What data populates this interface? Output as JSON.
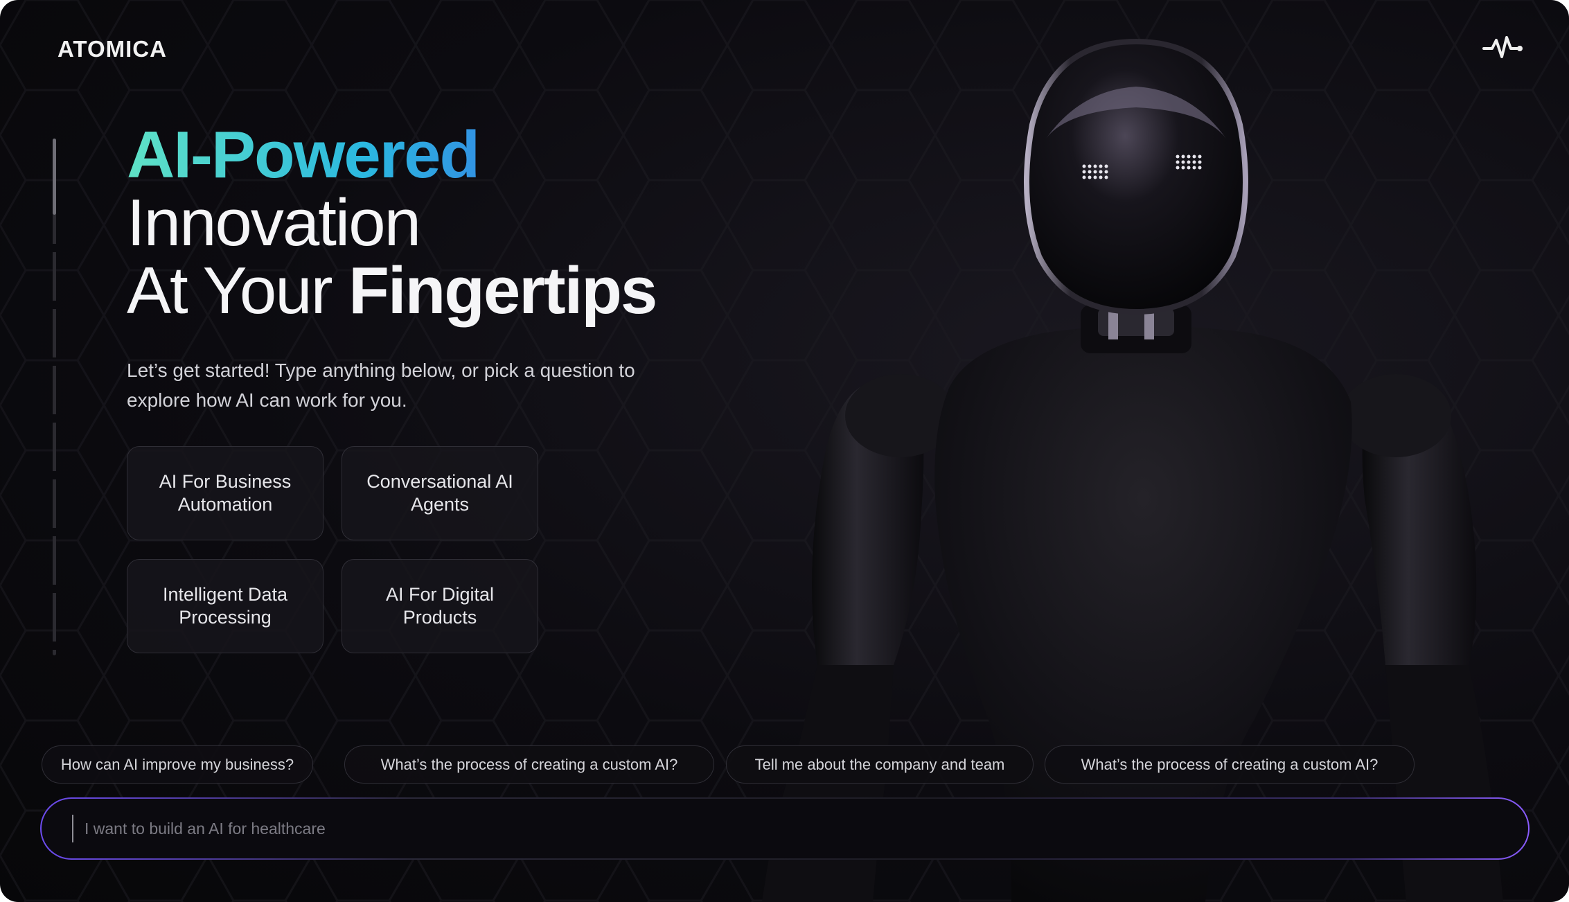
{
  "brand": {
    "name": "ATOMICA"
  },
  "header": {
    "pulse_icon": "pulse-icon"
  },
  "hero": {
    "line1": "AI-Powered",
    "line2": "Innovation",
    "line3_regular": "At Your ",
    "line3_bold": "Fingertips",
    "subtitle": "Let’s get started! Type anything below, or pick a question to explore how AI can work for you."
  },
  "topics": [
    {
      "label": "AI For Business Automation"
    },
    {
      "label": "Conversational AI Agents"
    },
    {
      "label": "Intelligent Data Processing"
    },
    {
      "label": "AI For Digital Products"
    }
  ],
  "suggestions": [
    {
      "label": "How can AI improve my business?"
    },
    {
      "label": "What’s the process of creating a custom AI?"
    },
    {
      "label": "Tell me about the company and team"
    },
    {
      "label": "What’s the process of creating a custom AI?"
    }
  ],
  "chat": {
    "placeholder": "I want to build an AI for healthcare"
  },
  "colors": {
    "accent_gradient_start": "#5fe2c6",
    "accent_gradient_end": "#3c5ae8",
    "input_glow": "#8a5cff"
  }
}
